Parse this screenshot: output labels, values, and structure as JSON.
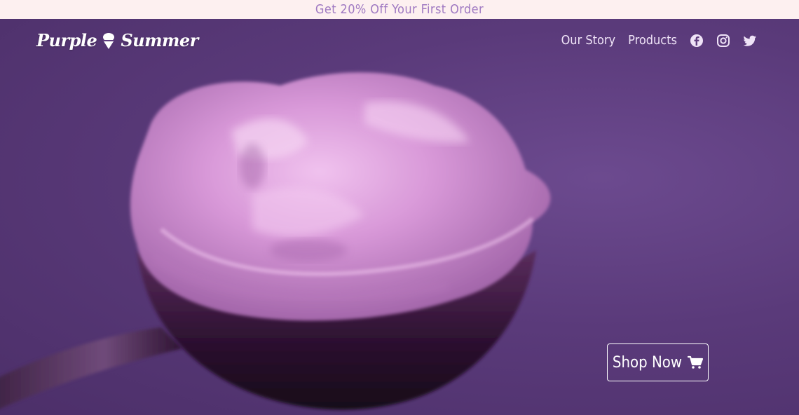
{
  "promo": {
    "text": "Get 20% Off Your First Order"
  },
  "header": {
    "logo_text_left": "Purple",
    "logo_text_right": "Summer",
    "logo_icon": "ice-cream-cone-icon",
    "nav": [
      {
        "label": "Our Story"
      },
      {
        "label": "Products"
      }
    ],
    "social_icons": [
      "facebook-icon",
      "instagram-icon",
      "twitter-icon"
    ]
  },
  "hero": {
    "image": "ice-cream-scoop-photo",
    "cta_label": "Shop Now",
    "cta_icon": "cart-icon"
  },
  "colors": {
    "promo_bg": "#fdf0f0",
    "promo_text": "#a07ac2",
    "hero_bg": "#5f3d7e",
    "ice_cream": "#d89ad9"
  }
}
